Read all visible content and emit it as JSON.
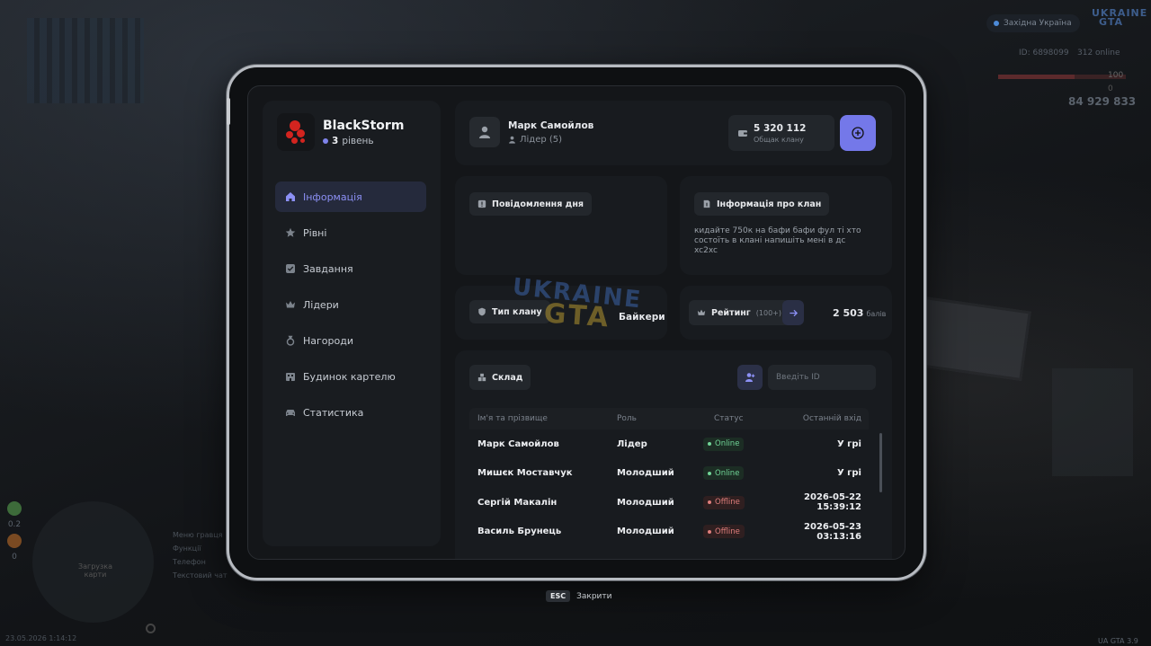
{
  "hud": {
    "region": "Західна Україна",
    "logo_top": "UKRAINE",
    "logo_bottom": "GTA",
    "id_text": "ID: 6898099",
    "online_text": "312 online",
    "hp": "100",
    "armor": "0",
    "money": "84 929 833",
    "radar_label": "Загрузка карти",
    "left_values": [
      "0.2",
      "0"
    ],
    "keys": [
      "Меню гравця",
      "Функції",
      "Телефон",
      "Текстовий чат"
    ],
    "datetime": "23.05.2026 1:14:12",
    "version": "UA GTA 3.9"
  },
  "watermark": {
    "top": "UKRAINE",
    "bottom": "GTA"
  },
  "clan": {
    "name": "BlackStorm",
    "level_num": "3",
    "level_word": "рівень"
  },
  "nav": {
    "items": [
      {
        "label": "Інформація",
        "icon": "home-icon",
        "active": true
      },
      {
        "label": "Рівні",
        "icon": "star-icon"
      },
      {
        "label": "Завдання",
        "icon": "checkbox-icon"
      },
      {
        "label": "Лідери",
        "icon": "crown-icon"
      },
      {
        "label": "Нагороди",
        "icon": "medal-icon"
      },
      {
        "label": "Будинок картелю",
        "icon": "building-icon"
      },
      {
        "label": "Статистика",
        "icon": "car-icon"
      }
    ]
  },
  "leader": {
    "name": "Марк Самойлов",
    "role": "Лідер (5)"
  },
  "bank": {
    "amount": "5 320 112",
    "label": "Общак клану"
  },
  "motd": {
    "title": "Повідомлення дня",
    "text": ""
  },
  "clan_info": {
    "title": "Інформація про клан",
    "text": "кидайте 750к на бафи бафи фул ті хто состоїть в клані напишіть мені в дс xc2xc"
  },
  "clan_type": {
    "label": "Тип клану",
    "value": "Байкери"
  },
  "rating": {
    "label": "Рейтинг",
    "sub": "(100+)",
    "value": "2 503",
    "unit": "балів"
  },
  "warehouse": {
    "label": "Склад"
  },
  "search": {
    "placeholder": "Введіть ID"
  },
  "members": {
    "headers": [
      "Ім'я та прізвище",
      "Роль",
      "Статус",
      "Останній вхід"
    ],
    "rows": [
      {
        "name": "Марк Самойлов",
        "role": "Лідер",
        "status": "Online",
        "last": "У грі"
      },
      {
        "name": "Мишєк Моставчук",
        "role": "Молодший",
        "status": "Online",
        "last": "У грі"
      },
      {
        "name": "Сергій Макалін",
        "role": "Молодший",
        "status": "Offline",
        "last": "2026-05-22 15:39:12"
      },
      {
        "name": "Василь Брунець",
        "role": "Молодший",
        "status": "Offline",
        "last": "2026-05-23 03:13:16"
      }
    ]
  },
  "footer": {
    "key": "ESC",
    "label": "Закрити"
  },
  "colors": {
    "accent": "#7478e9",
    "online": "#71d597",
    "offline": "#e07e7c"
  }
}
